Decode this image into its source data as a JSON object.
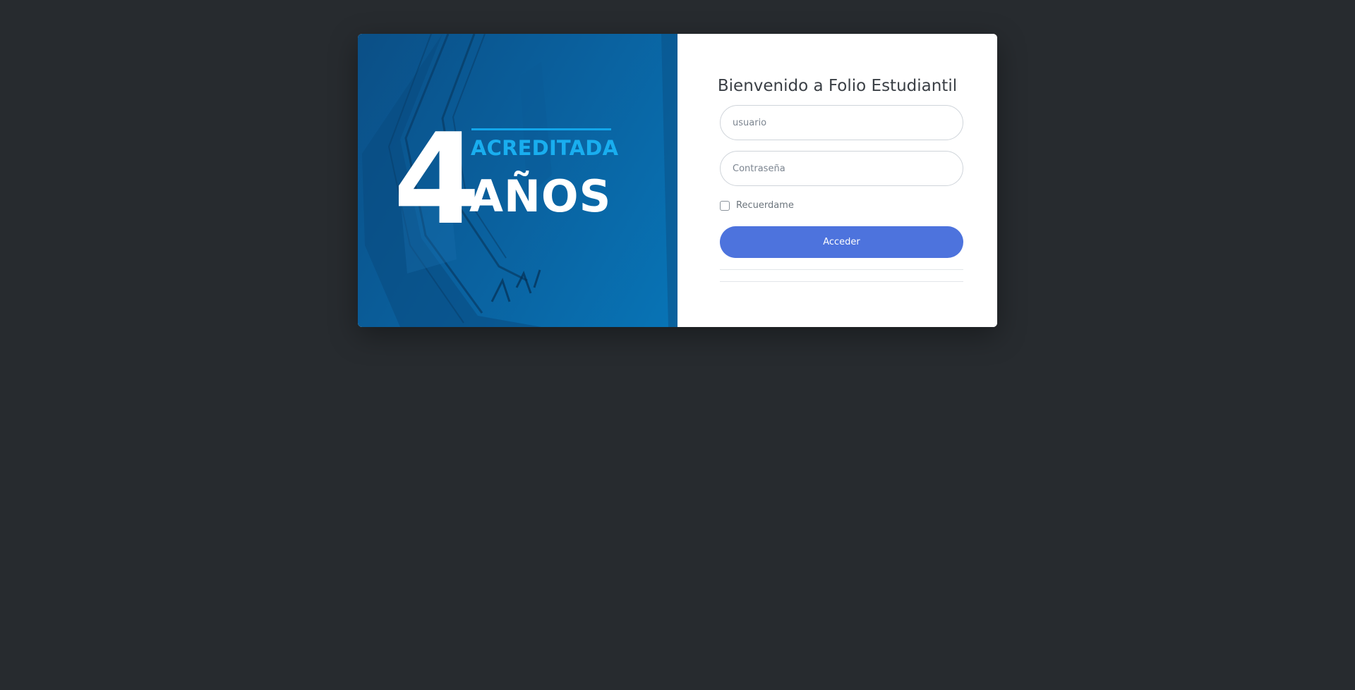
{
  "banner": {
    "number": "4",
    "accredited": "ACREDITADA",
    "years": "AÑOS",
    "colors": {
      "accent": "#19aeef",
      "background": "#0a5f9c"
    }
  },
  "form": {
    "title": "Bienvenido a Folio Estudiantil",
    "username_placeholder": "usuario",
    "username_value": "",
    "password_placeholder": "Contraseña",
    "password_value": "",
    "remember_label": "Recuerdame",
    "remember_checked": false,
    "submit_label": "Acceder",
    "colors": {
      "button": "#4d73dd",
      "page_background": "#272b2f"
    }
  }
}
